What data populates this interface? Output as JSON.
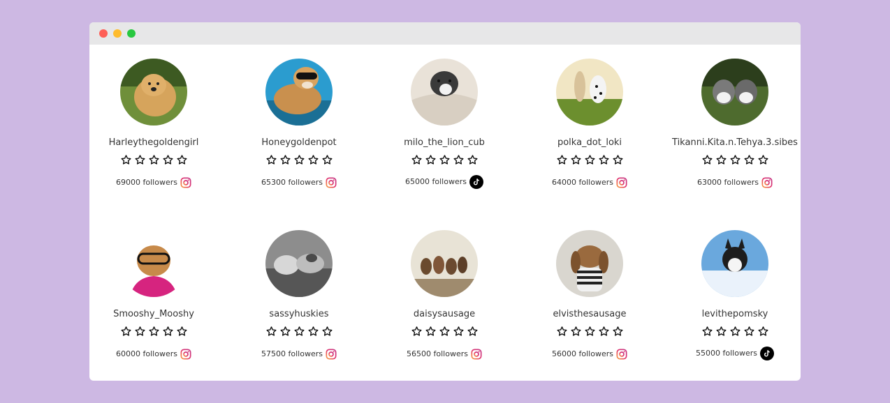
{
  "window": {
    "controls": [
      "close",
      "minimize",
      "maximize"
    ]
  },
  "profiles": [
    {
      "name": "Harleythegoldengirl",
      "rating": 0,
      "followers": "69000 followers",
      "platform": "instagram-icon"
    },
    {
      "name": "Honeygoldenpot",
      "rating": 0,
      "followers": "65300 followers",
      "platform": "instagram-icon"
    },
    {
      "name": "milo_the_lion_cub",
      "rating": 0,
      "followers": "65000 followers",
      "platform": "tiktok-icon"
    },
    {
      "name": "polka_dot_loki",
      "rating": 0,
      "followers": "64000 followers",
      "platform": "instagram-icon"
    },
    {
      "name": "Tikanni.Kita.n.Tehya.3.sibes",
      "rating": 0,
      "followers": "63000 followers",
      "platform": "instagram-icon"
    },
    {
      "name": "Smooshy_Mooshy",
      "rating": 0,
      "followers": "60000 followers",
      "platform": "instagram-icon"
    },
    {
      "name": "sassyhuskies",
      "rating": 0,
      "followers": "57500 followers",
      "platform": "instagram-icon"
    },
    {
      "name": "daisysausage",
      "rating": 0,
      "followers": "56500 followers",
      "platform": "instagram-icon"
    },
    {
      "name": "elvisthesausage",
      "rating": 0,
      "followers": "56000 followers",
      "platform": "instagram-icon"
    },
    {
      "name": "levithepomsky",
      "rating": 0,
      "followers": "55000 followers",
      "platform": "tiktok-icon"
    }
  ],
  "colors": {
    "background": "#cdb8e3",
    "window": "#ffffff",
    "titlebar": "#e7e7e8",
    "close": "#fe5f57",
    "minimize": "#febc2e",
    "maximize": "#28c840"
  }
}
